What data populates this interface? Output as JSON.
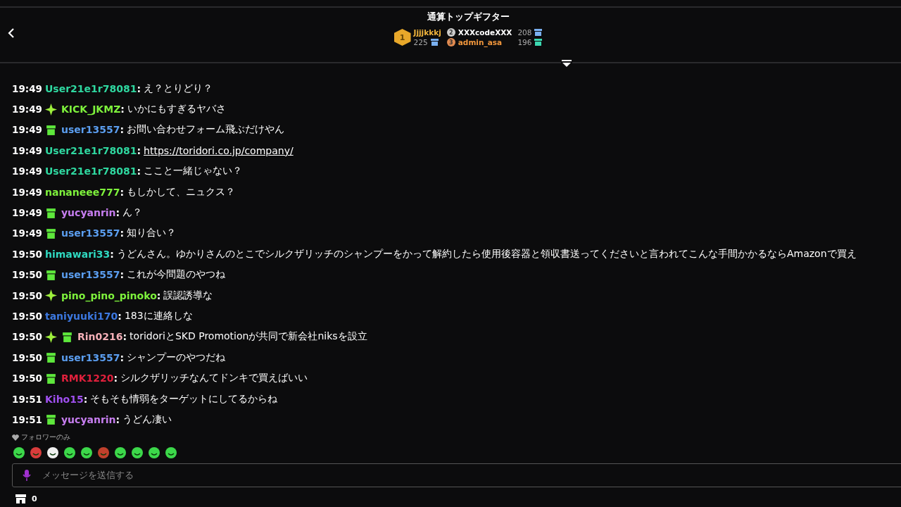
{
  "header": {
    "title": "通算トップギフター",
    "gifters": [
      {
        "rank": "1",
        "name": "Jjjjkkkj",
        "count": "225",
        "color": "#f0b43c"
      },
      {
        "rank": "2",
        "name": "XXXcodeXXX",
        "count": "208",
        "color": "#ffffff"
      },
      {
        "rank": "3",
        "name": "admin_asa",
        "count": "196",
        "color": "#f0963c"
      }
    ]
  },
  "messages": [
    {
      "time": "19:49",
      "user": "User21e1r78081",
      "separator": ":",
      "color": "#2fd8a0",
      "text": "え？とりどり？"
    },
    {
      "time": "19:49",
      "verified": true,
      "user": "KICK_JKMZ",
      "separator": ":",
      "color": "#7ef23c",
      "text": "いかにもすぎるヤバさ"
    },
    {
      "time": "19:49",
      "gifter": true,
      "user": "user13557",
      "separator": ":",
      "color": "#5b9ef0",
      "text": "お問い合わせフォーム飛ぶだけやん"
    },
    {
      "time": "19:49",
      "user": "User21e1r78081",
      "separator": ":",
      "color": "#2fd8a0",
      "text": "https://toridori.co.jp/company/",
      "kind": "link"
    },
    {
      "time": "19:49",
      "user": "User21e1r78081",
      "separator": ":",
      "color": "#2fd8a0",
      "text": "ここと一緒じゃない？"
    },
    {
      "time": "19:49",
      "user": "nananeee777",
      "separator": ":",
      "color": "#7ef23c",
      "text": "もしかして、ニュクス？"
    },
    {
      "time": "19:49",
      "gifter": true,
      "user": "yucyanrin",
      "separator": ":",
      "color": "#c77ef0",
      "text": "ん？"
    },
    {
      "time": "19:49",
      "gifter": true,
      "user": "user13557",
      "separator": ":",
      "color": "#5b9ef0",
      "text": "知り合い？"
    },
    {
      "time": "19:50",
      "user": "himawari33",
      "separator": ":",
      "color": "#2fd8c0",
      "text": "うどんさん。ゆかりさんのとこでシルクザリッチのシャンプーをかって解約したら使用後容器と領収書送ってくださいと言われてこんな手間かかるならAmazonで買え"
    },
    {
      "time": "19:50",
      "gifter": true,
      "user": "user13557",
      "separator": ":",
      "color": "#5b9ef0",
      "text": "これが今問題のやつね"
    },
    {
      "time": "19:50",
      "verified": true,
      "user": "pino_pino_pinoko",
      "separator": ":",
      "color": "#7ef23c",
      "text": "誤認誘導な"
    },
    {
      "time": "19:50",
      "user": "taniyuuki170",
      "separator": ":",
      "color": "#3c78e0",
      "text": "183に連絡しな"
    },
    {
      "time": "19:50",
      "verified": true,
      "gifter": true,
      "user": "Rin0216",
      "separator": ":",
      "color": "#f5b0b8",
      "text": "toridoriとSKD Promotionが共同で新会社niksを設立"
    },
    {
      "time": "19:50",
      "gifter": true,
      "user": "user13557",
      "separator": ":",
      "color": "#5b9ef0",
      "text": "シャンプーのやつだね"
    },
    {
      "time": "19:50",
      "gifter": true,
      "user": "RMK1220",
      "separator": ":",
      "color": "#e0203c",
      "text": "シルクザリッチなんてドンキで買えばいい"
    },
    {
      "time": "19:51",
      "user": "Kiho15",
      "separator": ":",
      "color": "#a050f0",
      "text": "そもそも情弱をターゲットにしてるからね"
    },
    {
      "time": "19:51",
      "gifter": true,
      "user": "yucyanrin",
      "separator": ":",
      "color": "#c77ef0",
      "text": "うどん凄い"
    }
  ],
  "mode_label": "フォロワーのみ",
  "input": {
    "placeholder": "メッセージを送信する"
  },
  "footer": {
    "points": "0"
  }
}
